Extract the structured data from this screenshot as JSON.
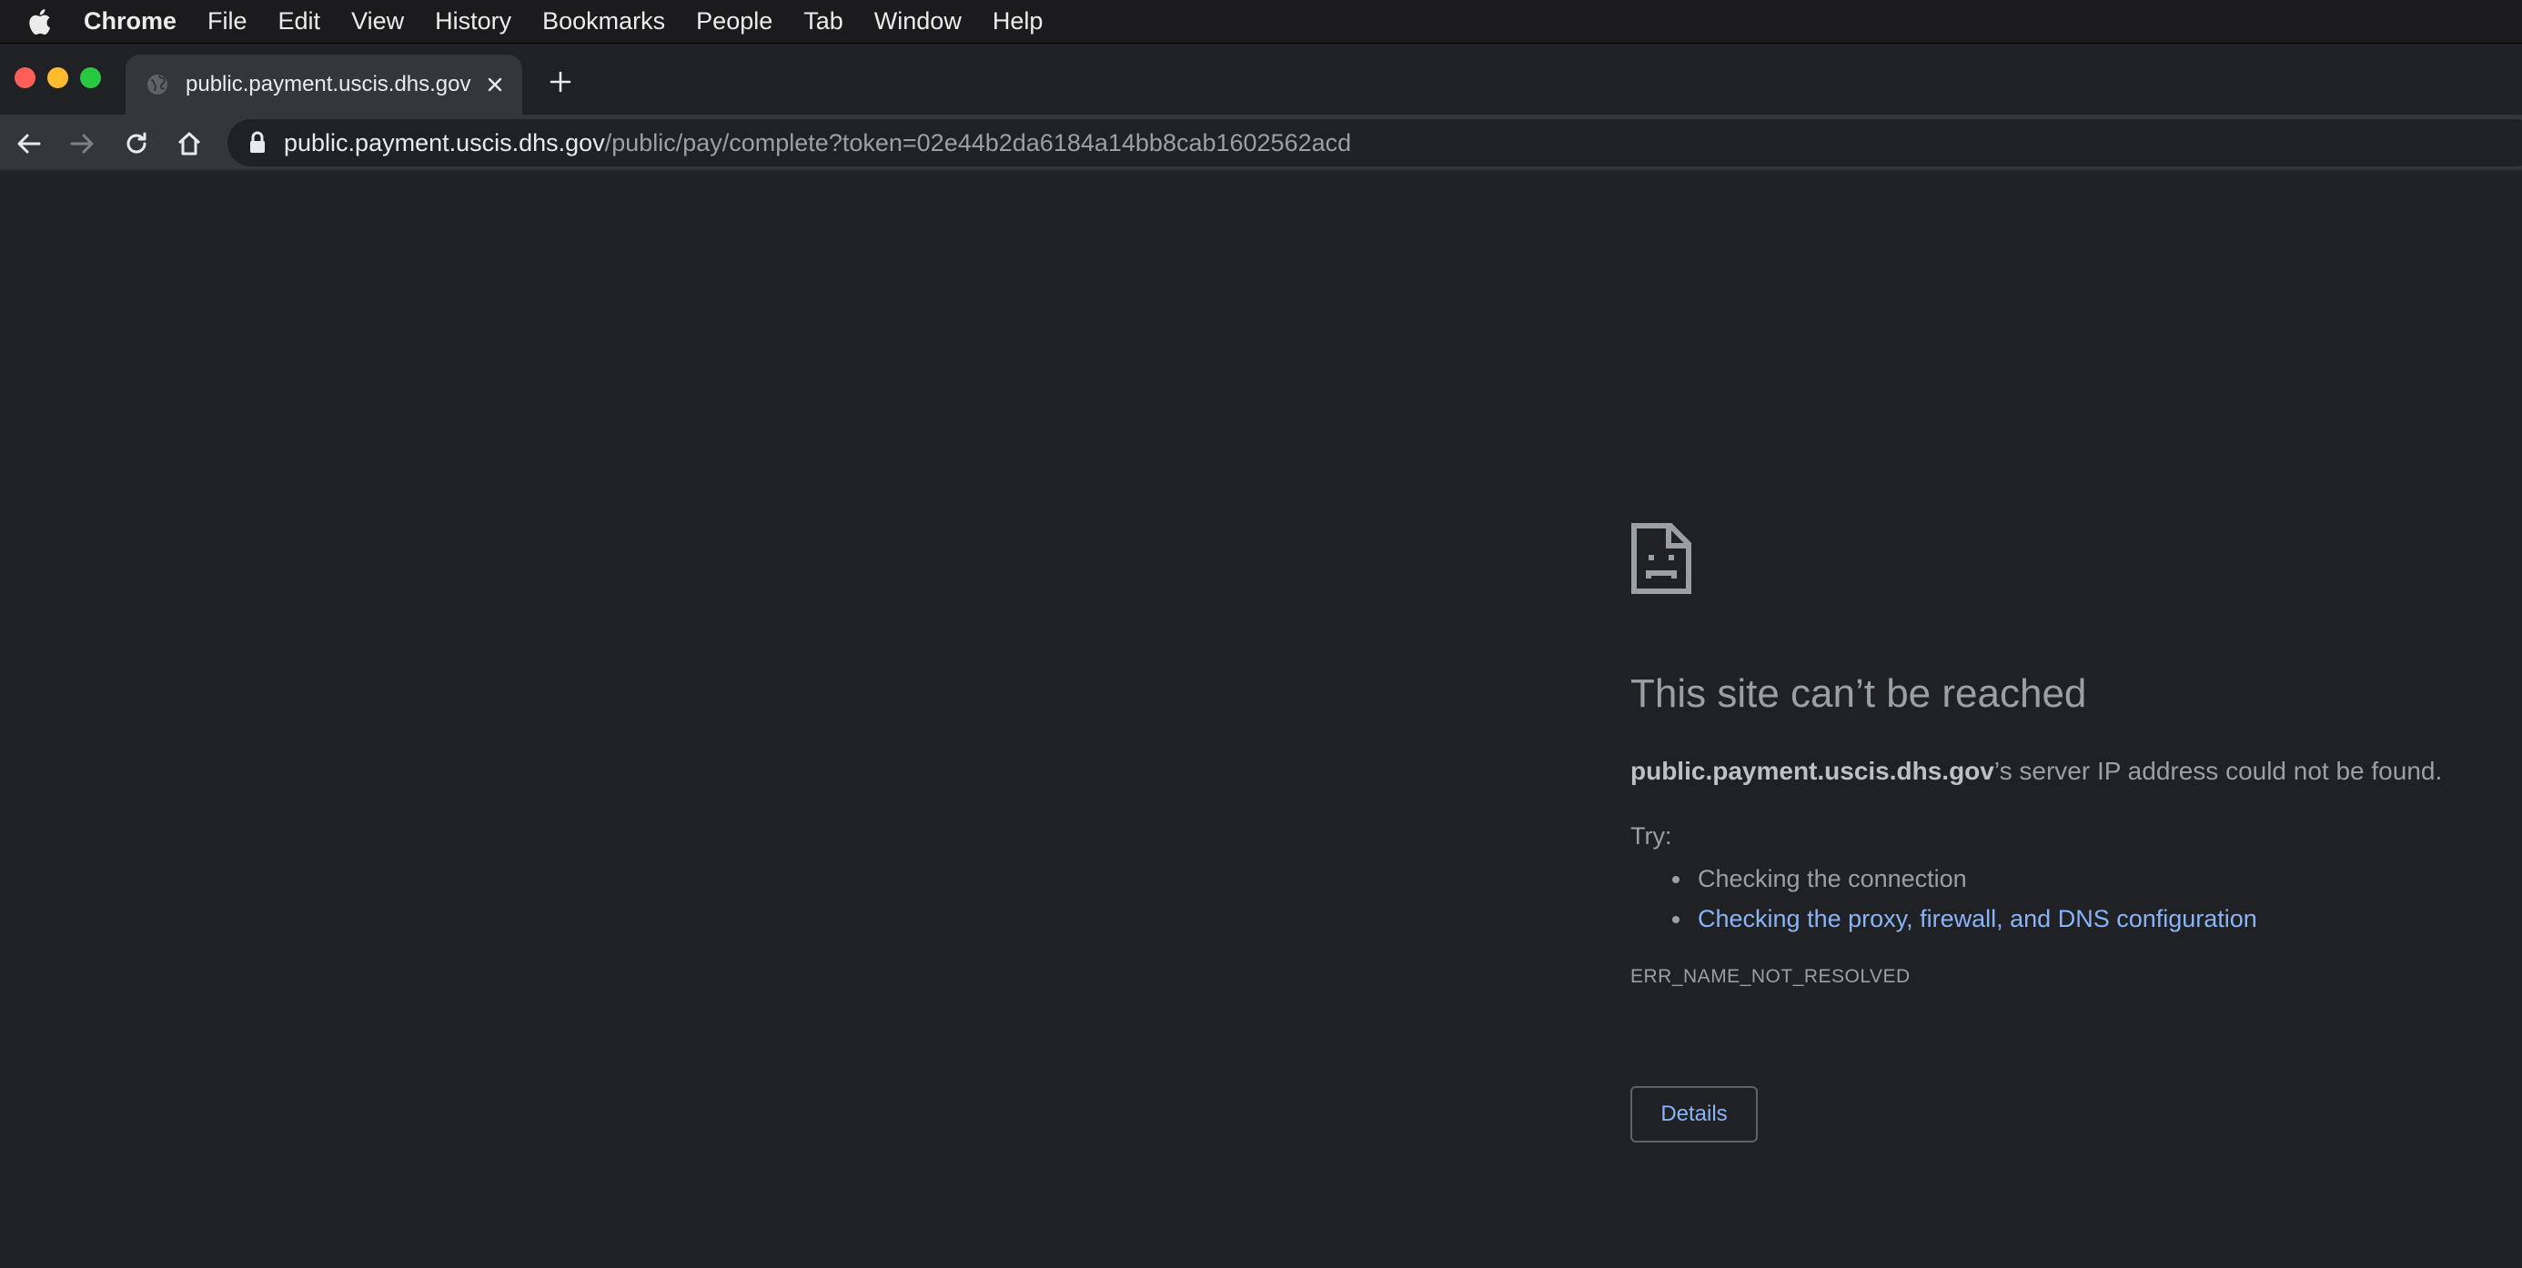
{
  "menubar": {
    "app_name": "Chrome",
    "items": [
      "File",
      "Edit",
      "View",
      "History",
      "Bookmarks",
      "People",
      "Tab",
      "Window",
      "Help"
    ]
  },
  "tab": {
    "title": "public.payment.uscis.dhs.gov"
  },
  "omnibox": {
    "host": "public.payment.uscis.dhs.gov",
    "path": "/public/pay/complete?token=02e44b2da6184a14bb8cab1602562acd"
  },
  "error": {
    "title": "This site can’t be reached",
    "host": "public.payment.uscis.dhs.gov",
    "description_suffix": "’s server IP address could not be found.",
    "try_label": "Try:",
    "suggestions": [
      "Checking the connection",
      "Checking the proxy, firewall, and DNS configuration"
    ],
    "code": "ERR_NAME_NOT_RESOLVED",
    "details_label": "Details"
  },
  "colors": {
    "background": "#202124",
    "toolbar": "#35363a",
    "link": "#8ab4f8",
    "text_secondary": "#9aa0a6"
  }
}
